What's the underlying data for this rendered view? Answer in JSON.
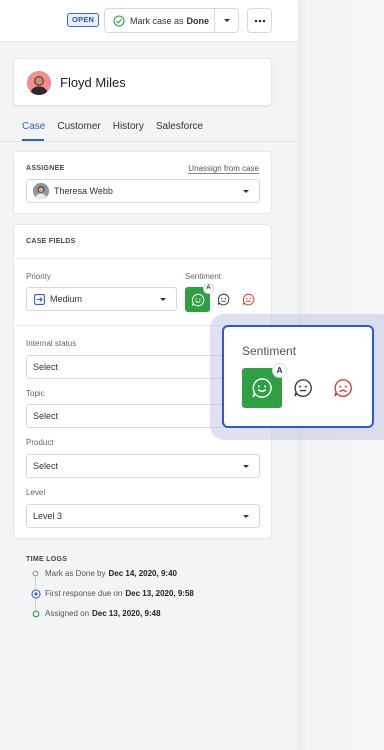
{
  "topbar": {
    "status_badge": "OPEN",
    "mark_done_prefix": "Mark case as",
    "mark_done_strong": "Done"
  },
  "contact": {
    "name": "Floyd Miles"
  },
  "tabs": [
    {
      "label": "Case",
      "active": true
    },
    {
      "label": "Customer",
      "active": false
    },
    {
      "label": "History",
      "active": false
    },
    {
      "label": "Salesforce",
      "active": false
    }
  ],
  "assignee": {
    "section_label": "ASSIGNEE",
    "unassign_link": "Unassign from case",
    "value": "Theresa Webb"
  },
  "case_fields": {
    "section_label": "CASE FIELDS",
    "priority": {
      "label": "Priority",
      "value": "Medium"
    },
    "sentiment": {
      "label": "Sentiment",
      "options": [
        "positive-face-icon",
        "neutral-face-icon",
        "negative-face-icon"
      ],
      "selected": "positive",
      "auto_badge": "A"
    },
    "internal_status": {
      "label": "Internal status",
      "placeholder": "Select"
    },
    "topic": {
      "label": "Topic",
      "placeholder": "Select"
    },
    "product": {
      "label": "Product",
      "placeholder": "Select"
    },
    "level": {
      "label": "Level",
      "value": "Level 3"
    }
  },
  "time_logs": {
    "section_label": "TIME LOGS",
    "entries": [
      {
        "text": "Mark as Done by",
        "strong": "Dec 14, 2020, 9:40"
      },
      {
        "text": "First response due on",
        "strong": "Dec 13, 2020, 9:58"
      },
      {
        "text": "Assigned on",
        "strong": "Dec 13, 2020, 9:48"
      }
    ]
  },
  "popup": {
    "title": "Sentiment",
    "auto_badge": "A"
  },
  "colors": {
    "accent": "#2f5ed8",
    "positive": "#2ea043",
    "negative": "#d9342b",
    "popup_border": "#3256d8"
  }
}
